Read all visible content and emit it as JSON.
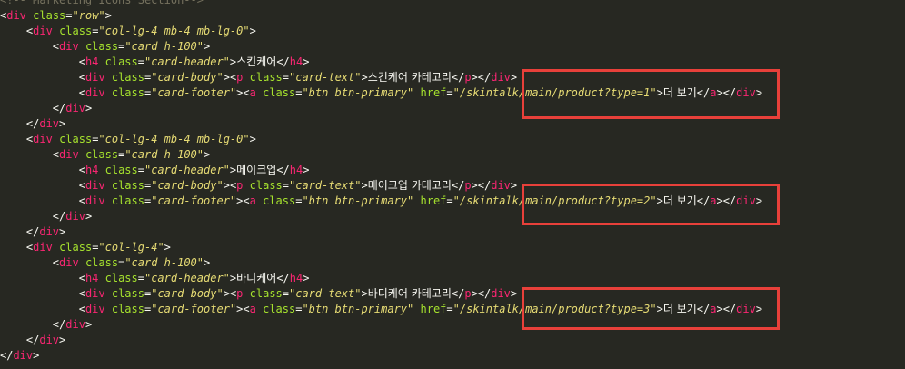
{
  "editor": {
    "lines": [
      "<!-- Marketing Icons Section-->",
      "<div class=\"row\">",
      "    <div class=\"col-lg-4 mb-4 mb-lg-0\">",
      "        <div class=\"card h-100\">",
      "            <h4 class=\"card-header\">스킨케어</h4>",
      "            <div class=\"card-body\"><p class=\"card-text\">스킨케어 카테고리</p></div>",
      "            <div class=\"card-footer\"><a class=\"btn btn-primary\" href=\"/skintalk/main/product?type=1\">더 보기</a></div>",
      "        </div>",
      "    </div>",
      "    <div class=\"col-lg-4 mb-4 mb-lg-0\">",
      "        <div class=\"card h-100\">",
      "            <h4 class=\"card-header\">메이크업</h4>",
      "            <div class=\"card-body\"><p class=\"card-text\">메이크업 카테고리</p></div>",
      "            <div class=\"card-footer\"><a class=\"btn btn-primary\" href=\"/skintalk/main/product?type=2\">더 보기</a></div>",
      "        </div>",
      "    </div>",
      "    <div class=\"col-lg-4\">",
      "        <div class=\"card h-100\">",
      "            <h4 class=\"card-header\">바디케어</h4>",
      "            <div class=\"card-body\"><p class=\"card-text\">바디케어 카테고리</p></div>",
      "            <div class=\"card-footer\"><a class=\"btn btn-primary\" href=\"/skintalk/main/product?type=3\">더 보기</a></div>",
      "        </div>",
      "    </div>",
      "</div>"
    ]
  },
  "colors": {
    "background": "#272822",
    "tag": "#f92672",
    "attribute": "#a6e22e",
    "string": "#e6db74",
    "text": "#f8f8f2",
    "comment": "#75715e",
    "highlight_box": "#e8403a"
  }
}
